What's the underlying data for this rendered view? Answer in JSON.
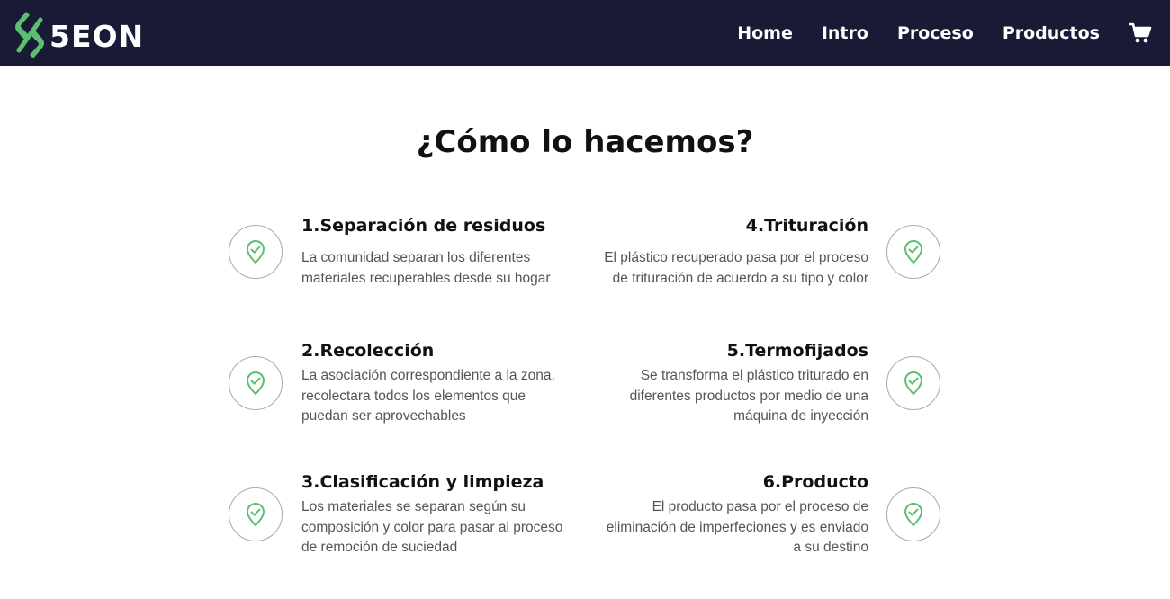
{
  "brand": {
    "name": "5EON",
    "accent_color": "#5bbf6f",
    "nav_bg": "#191a36"
  },
  "nav": {
    "links": [
      "Home",
      "Intro",
      "Proceso",
      "Productos"
    ],
    "cart_icon": "shopping-cart-icon"
  },
  "section": {
    "title": "¿Cómo lo hacemos?"
  },
  "steps": [
    {
      "title": "1.Separación de residuos",
      "lines": [
        "La comunidad separan los diferentes",
        "materiales recuperables desde su hogar"
      ],
      "icon": "location-check-icon"
    },
    {
      "title": "2.Recolección",
      "lines": [
        "La asociación correspondiente a la zona,",
        "recolectara todos los elementos que",
        "puedan ser aprovechables"
      ],
      "icon": "location-check-icon"
    },
    {
      "title": "3.Clasificación y limpieza",
      "lines": [
        "Los materiales se separan según su",
        "composición y color para pasar al proceso",
        "de remoción de suciedad"
      ],
      "icon": "location-check-icon"
    },
    {
      "title": "4.Trituración",
      "lines": [
        "El plástico recuperado pasa por el proceso",
        "de trituración de acuerdo a su tipo y color"
      ],
      "icon": "location-check-icon"
    },
    {
      "title": "5.Termofijados",
      "lines": [
        "Se transforma el plástico triturado en",
        "diferentes productos por medio de una",
        "máquina de inyección"
      ],
      "icon": "location-check-icon"
    },
    {
      "title": "6.Producto",
      "lines": [
        "El producto pasa por el proceso de",
        "eliminación de imperfeciones y es enviado",
        "a su destino"
      ],
      "icon": "location-check-icon"
    }
  ]
}
